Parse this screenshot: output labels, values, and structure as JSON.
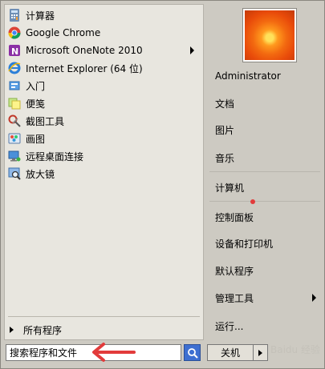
{
  "left": {
    "programs": [
      {
        "label": "计算器",
        "icon": "calculator-icon",
        "has_submenu": false
      },
      {
        "label": "Google Chrome",
        "icon": "chrome-icon",
        "has_submenu": false
      },
      {
        "label": "Microsoft OneNote 2010",
        "icon": "onenote-icon",
        "has_submenu": true
      },
      {
        "label": "Internet Explorer (64 位)",
        "icon": "ie-icon",
        "has_submenu": false
      },
      {
        "label": "入门",
        "icon": "getting-started-icon",
        "has_submenu": false
      },
      {
        "label": "便笺",
        "icon": "sticky-notes-icon",
        "has_submenu": false
      },
      {
        "label": "截图工具",
        "icon": "snipping-tool-icon",
        "has_submenu": false
      },
      {
        "label": "画图",
        "icon": "paint-icon",
        "has_submenu": false
      },
      {
        "label": "远程桌面连接",
        "icon": "remote-desktop-icon",
        "has_submenu": false
      },
      {
        "label": "放大镜",
        "icon": "magnifier-icon",
        "has_submenu": false
      }
    ],
    "all_programs_label": "所有程序"
  },
  "search": {
    "value": "搜索程序和文件"
  },
  "right": {
    "user": "Administrator",
    "items": [
      {
        "label": "文档"
      },
      {
        "label": "图片"
      },
      {
        "label": "音乐"
      },
      {
        "label": "计算机"
      },
      {
        "label": "控制面板"
      },
      {
        "label": "设备和打印机"
      },
      {
        "label": "默认程序"
      },
      {
        "label": "管理工具",
        "has_submenu": true
      },
      {
        "label": "运行..."
      }
    ]
  },
  "shutdown_label": "关机",
  "watermark": "Baidu 经验",
  "colors": {
    "search_button": "#3d6fd1",
    "annotation_arrow": "#e23b3b"
  }
}
